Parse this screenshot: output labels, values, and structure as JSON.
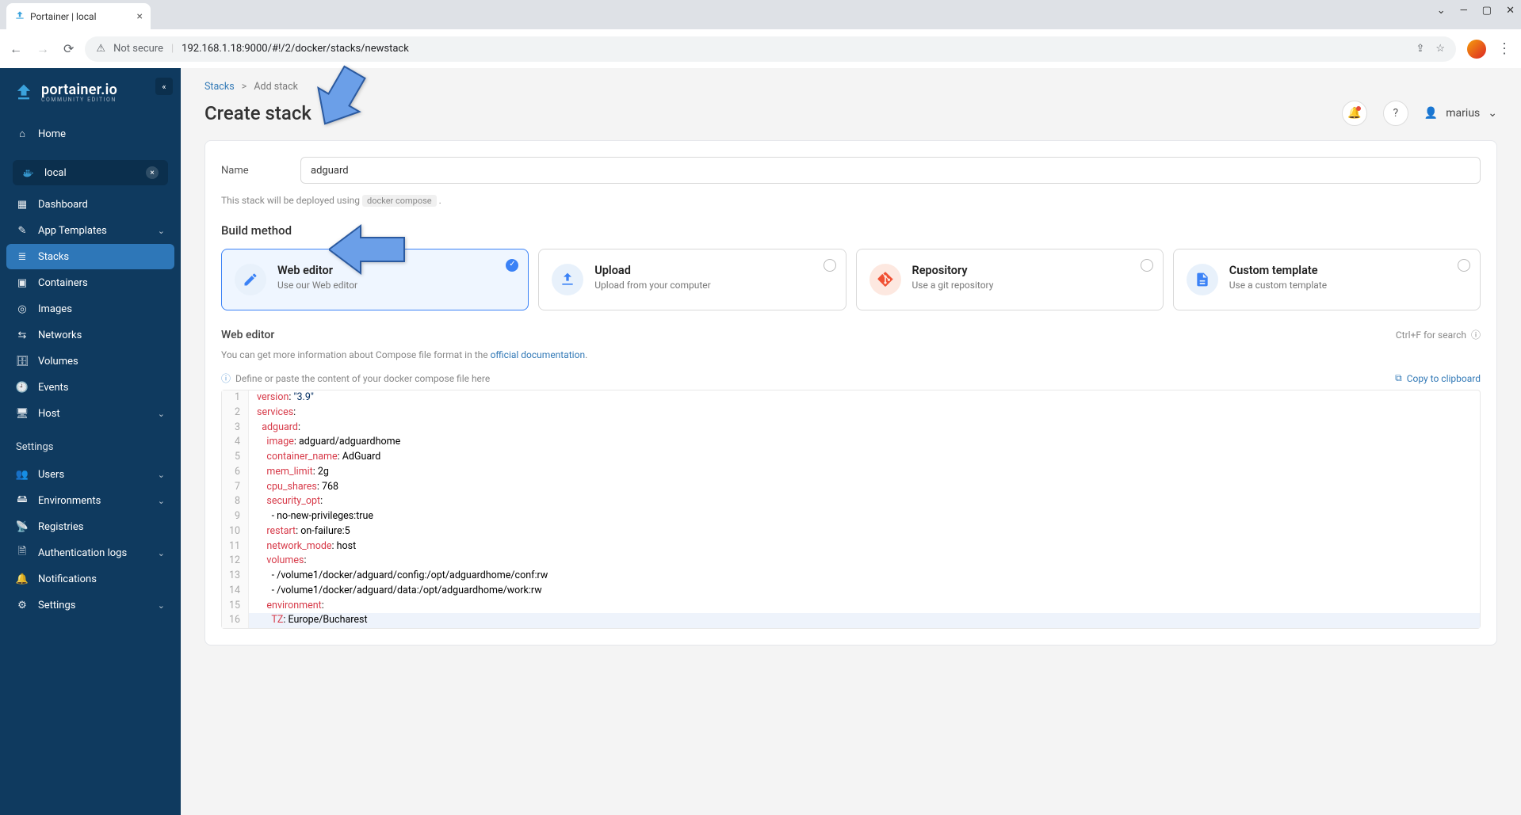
{
  "browser": {
    "tab_title": "Portainer | local",
    "not_secure": "Not secure",
    "url": "192.168.1.18:9000/#!/2/docker/stacks/newstack"
  },
  "sidebar": {
    "brand": "portainer.io",
    "brand_sub": "COMMUNITY EDITION",
    "home": "Home",
    "env": "local",
    "items": [
      "Dashboard",
      "App Templates",
      "Stacks",
      "Containers",
      "Images",
      "Networks",
      "Volumes",
      "Events",
      "Host"
    ],
    "settings_label": "Settings",
    "settings_items": [
      "Users",
      "Environments",
      "Registries",
      "Authentication logs",
      "Notifications",
      "Settings"
    ]
  },
  "breadcrumb": {
    "root": "Stacks",
    "current": "Add stack"
  },
  "page_title": "Create stack",
  "user": "marius",
  "form": {
    "name_label": "Name",
    "name_value": "adguard",
    "deploy_note_pre": "This stack will be deployed using",
    "deploy_note_code": "docker compose",
    "build_method_label": "Build method"
  },
  "methods": [
    {
      "title": "Web editor",
      "desc": "Use our Web editor"
    },
    {
      "title": "Upload",
      "desc": "Upload from your computer"
    },
    {
      "title": "Repository",
      "desc": "Use a git repository"
    },
    {
      "title": "Custom template",
      "desc": "Use a custom template"
    }
  ],
  "editor": {
    "title": "Web editor",
    "search_hint": "Ctrl+F for search",
    "info_pre": "You can get more information about Compose file format in the ",
    "info_link": "official documentation",
    "placeholder_hint": "Define or paste the content of your docker compose file here",
    "copy_label": "Copy to clipboard",
    "lines": [
      "version: \"3.9\"",
      "services:",
      "  adguard:",
      "    image: adguard/adguardhome",
      "    container_name: AdGuard",
      "    mem_limit: 2g",
      "    cpu_shares: 768",
      "    security_opt:",
      "      - no-new-privileges:true",
      "    restart: on-failure:5",
      "    network_mode: host",
      "    volumes:",
      "      - /volume1/docker/adguard/config:/opt/adguardhome/conf:rw",
      "      - /volume1/docker/adguard/data:/opt/adguardhome/work:rw",
      "    environment:",
      "      TZ: Europe/Bucharest"
    ]
  }
}
